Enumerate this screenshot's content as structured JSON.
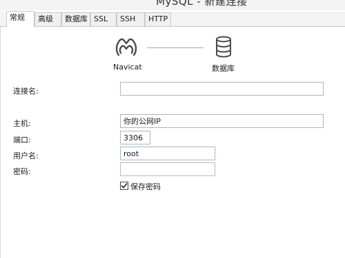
{
  "window": {
    "title": "MySQL - 新建连接"
  },
  "tabs": [
    {
      "label": "常规",
      "active": true
    },
    {
      "label": "高级",
      "active": false
    },
    {
      "label": "数据库",
      "active": false
    },
    {
      "label": "SSL",
      "active": false
    },
    {
      "label": "SSH",
      "active": false
    },
    {
      "label": "HTTP",
      "active": false
    }
  ],
  "diagram": {
    "left_label": "Navicat",
    "right_label": "数据库",
    "left_icon": "navicat-logo-icon",
    "right_icon": "database-icon"
  },
  "form": {
    "connection_name": {
      "label": "连接名:",
      "value": ""
    },
    "host": {
      "label": "主机:",
      "value": "你的公网IP"
    },
    "port": {
      "label": "端口:",
      "value": "3306"
    },
    "username": {
      "label": "用户名:",
      "value": "root"
    },
    "password": {
      "label": "密码:",
      "value": ""
    },
    "save_password": {
      "label": "保存密码",
      "checked": true
    }
  },
  "colors": {
    "field_border": "#a9b6c8",
    "tab_border": "#c9c9c9",
    "connector_line": "#a8a8a8"
  }
}
